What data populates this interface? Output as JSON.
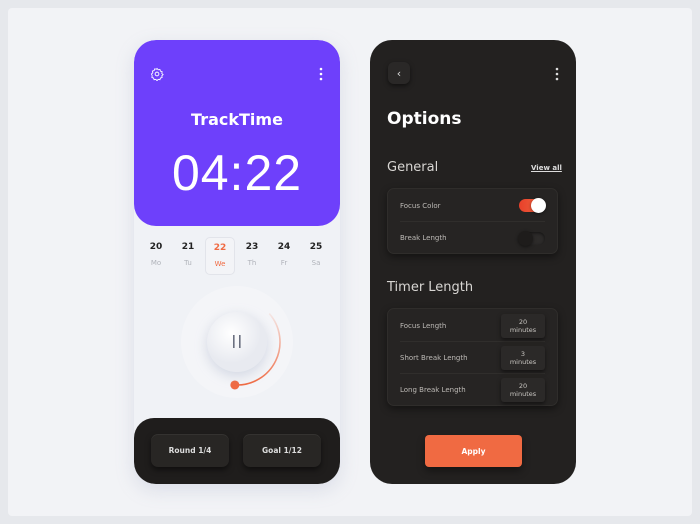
{
  "left": {
    "app_title": "TrackTime",
    "timer": "04:22",
    "days": [
      {
        "num": "20",
        "wd": "Mo"
      },
      {
        "num": "21",
        "wd": "Tu"
      },
      {
        "num": "22",
        "wd": "We",
        "selected": true
      },
      {
        "num": "23",
        "wd": "Th"
      },
      {
        "num": "24",
        "wd": "Fr"
      },
      {
        "num": "25",
        "wd": "Sa"
      }
    ],
    "round": "Round 1/4",
    "goal": "Goal 1/12",
    "pause_symbol": "II",
    "progress_fraction": 0.7
  },
  "right": {
    "title": "Options",
    "general": "General",
    "view_all": "View all",
    "focus_color": "Focus Color",
    "focus_color_on": true,
    "break_length": "Break Length",
    "break_length_on": false,
    "timer_length": "Timer Length",
    "timers": [
      {
        "label": "Focus Length",
        "value": "20 minutes"
      },
      {
        "label": "Short Break Length",
        "value": "3 minutes"
      },
      {
        "label": "Long Break Length",
        "value": "20 minutes"
      }
    ],
    "apply": "Apply"
  },
  "colors": {
    "accent": "#6e40fb",
    "orange": "#f06a42",
    "dark": "#232120"
  }
}
